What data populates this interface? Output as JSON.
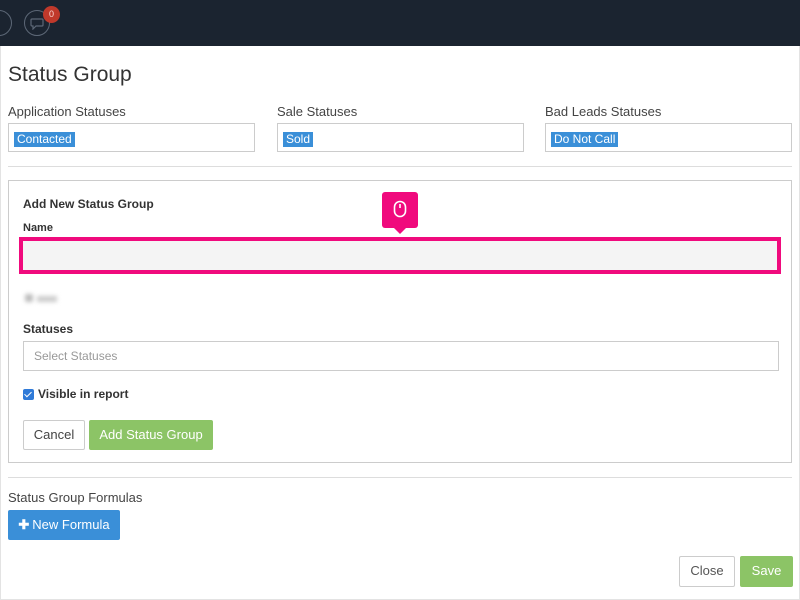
{
  "topbar": {
    "notification_count": "0"
  },
  "page_title": "Status Group",
  "status_columns": [
    {
      "label": "Application Statuses",
      "tag": "Contacted"
    },
    {
      "label": "Sale Statuses",
      "tag": "Sold"
    },
    {
      "label": "Bad Leads Statuses",
      "tag": "Do Not Call"
    }
  ],
  "add_group": {
    "title": "Add New Status Group",
    "name_label": "Name",
    "name_value": "",
    "statuses_label": "Statuses",
    "statuses_placeholder": "Select Statuses",
    "visible_label": "Visible in report",
    "visible_checked": true,
    "cancel_label": "Cancel",
    "add_label": "Add Status Group"
  },
  "formulas": {
    "label": "Status Group Formulas",
    "new_label": "New Formula"
  },
  "footer": {
    "close_label": "Close",
    "save_label": "Save"
  },
  "colors": {
    "topbar": "#1b2430",
    "accent_blue": "#3a8fd8",
    "accent_green": "#8cc466",
    "highlight_pink": "#f00a7d",
    "badge_red": "#c0392b"
  }
}
